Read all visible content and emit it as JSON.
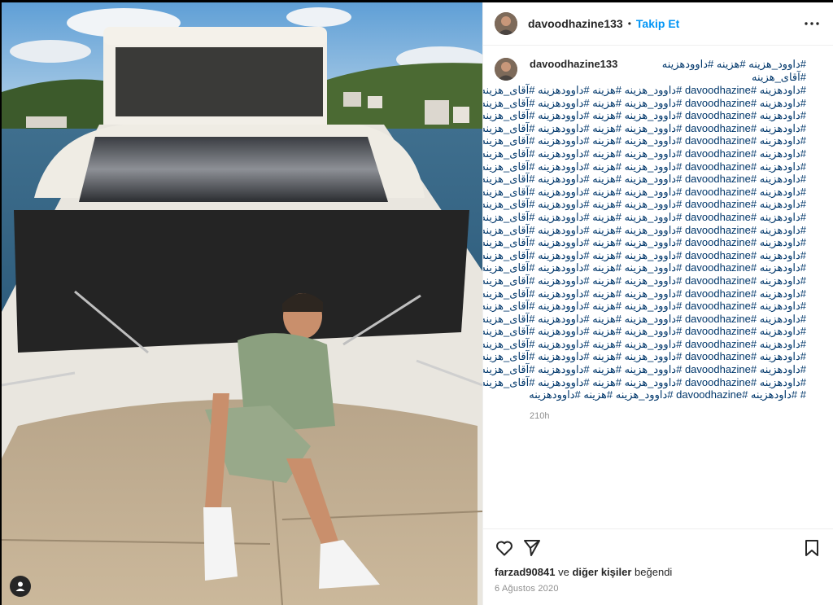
{
  "post": {
    "username": "davoodhazine133",
    "separator": "•",
    "follow_label": "Takip Et",
    "more_icon": "more-horizontal-icon",
    "caption": {
      "username": "davoodhazine133",
      "first_line": "#داوود_هزینه #هزینه #داوودهزینه #آقای_هزینه",
      "lines": [
        "#داودهزینه #davoodhazine #داوود_هزینه #هزینه #داوودهزینه #آقای_هزینه",
        "#داودهزینه #davoodhazine #داوود_هزینه #هزینه #داوودهزینه #آقای_هزینه",
        "#داودهزینه #davoodhazine #داوود_هزینه #هزینه #داوودهزینه #آقای_هزینه",
        "#داودهزینه #davoodhazine #داوود_هزینه #هزینه #داوودهزینه #آقای_هزینه",
        "#داودهزینه #davoodhazine #داوود_هزینه #هزینه #داوودهزینه #آقای_هزینه",
        "#داودهزینه #davoodhazine #داوود_هزینه #هزینه #داوودهزینه #آقای_هزینه",
        "#داودهزینه #davoodhazine #داوود_هزینه #هزینه #داوودهزینه #آقای_هزینه",
        "#داودهزینه #davoodhazine #داوود_هزینه #هزینه #داوودهزینه #آقای_هزینه",
        "#داودهزینه #davoodhazine #داوود_هزینه #هزینه #داوودهزینه #آقای_هزینه",
        "#داودهزینه #davoodhazine #داوود_هزینه #هزینه #داوودهزینه #آقای_هزینه",
        "#داودهزینه #davoodhazine #داوود_هزینه #هزینه #داوودهزینه #آقای_هزینه",
        "#داودهزینه #davoodhazine #داوود_هزینه #هزینه #داوودهزینه #آقای_هزینه",
        "#داودهزینه #davoodhazine #داوود_هزینه #هزینه #داوودهزینه #آقای_هزینه",
        "#داودهزینه #davoodhazine #داوود_هزینه #هزینه #داوودهزینه #آقای_هزینه",
        "#داودهزینه #davoodhazine #داوود_هزینه #هزینه #داوودهزینه #آقای_هزینه",
        "#داودهزینه #davoodhazine #داوود_هزینه #هزینه #داوودهزینه #آقای_هزینه",
        "#داودهزینه #davoodhazine #داوود_هزینه #هزینه #داوودهزینه #آقای_هزینه",
        "#داودهزینه #davoodhazine #داوود_هزینه #هزینه #داوودهزینه #آقای_هزینه",
        "#داودهزینه #davoodhazine #داوود_هزینه #هزینه #داوودهزینه #آقای_هزینه",
        "#داودهزینه #davoodhazine #داوود_هزینه #هزینه #داوودهزینه #آقای_هزینه",
        "#داودهزینه #davoodhazine #داوود_هزینه #هزینه #داوودهزینه #آقای_هزینه",
        "#داودهزینه #davoodhazine #داوود_هزینه #هزینه #داوودهزینه #آقای_هزینه",
        "#داودهزینه #davoodhazine #داوود_هزینه #هزینه #داوودهزینه #آقای_هزینه",
        "#داودهزینه #davoodhazine #داوود_هزینه #هزینه #داوودهزینه #آقای_هزینه",
        "# #داودهزینه #davoodhazine #داوود_هزینه #هزینه #داوودهزینه"
      ],
      "time_ago": "210h"
    },
    "actions": {
      "like_icon": "heart-icon",
      "share_icon": "send-icon",
      "save_icon": "bookmark-icon"
    },
    "likes": {
      "user": "farzad90841",
      "conj": "ve",
      "others": "diğer kişiler",
      "suffix": "beğendi"
    },
    "date": "6 Ağustos 2020",
    "tag_icon": "user-tag-icon"
  },
  "colors": {
    "link_blue": "#0095f6",
    "hashtag": "#00376b",
    "muted": "#8e8e8e"
  }
}
